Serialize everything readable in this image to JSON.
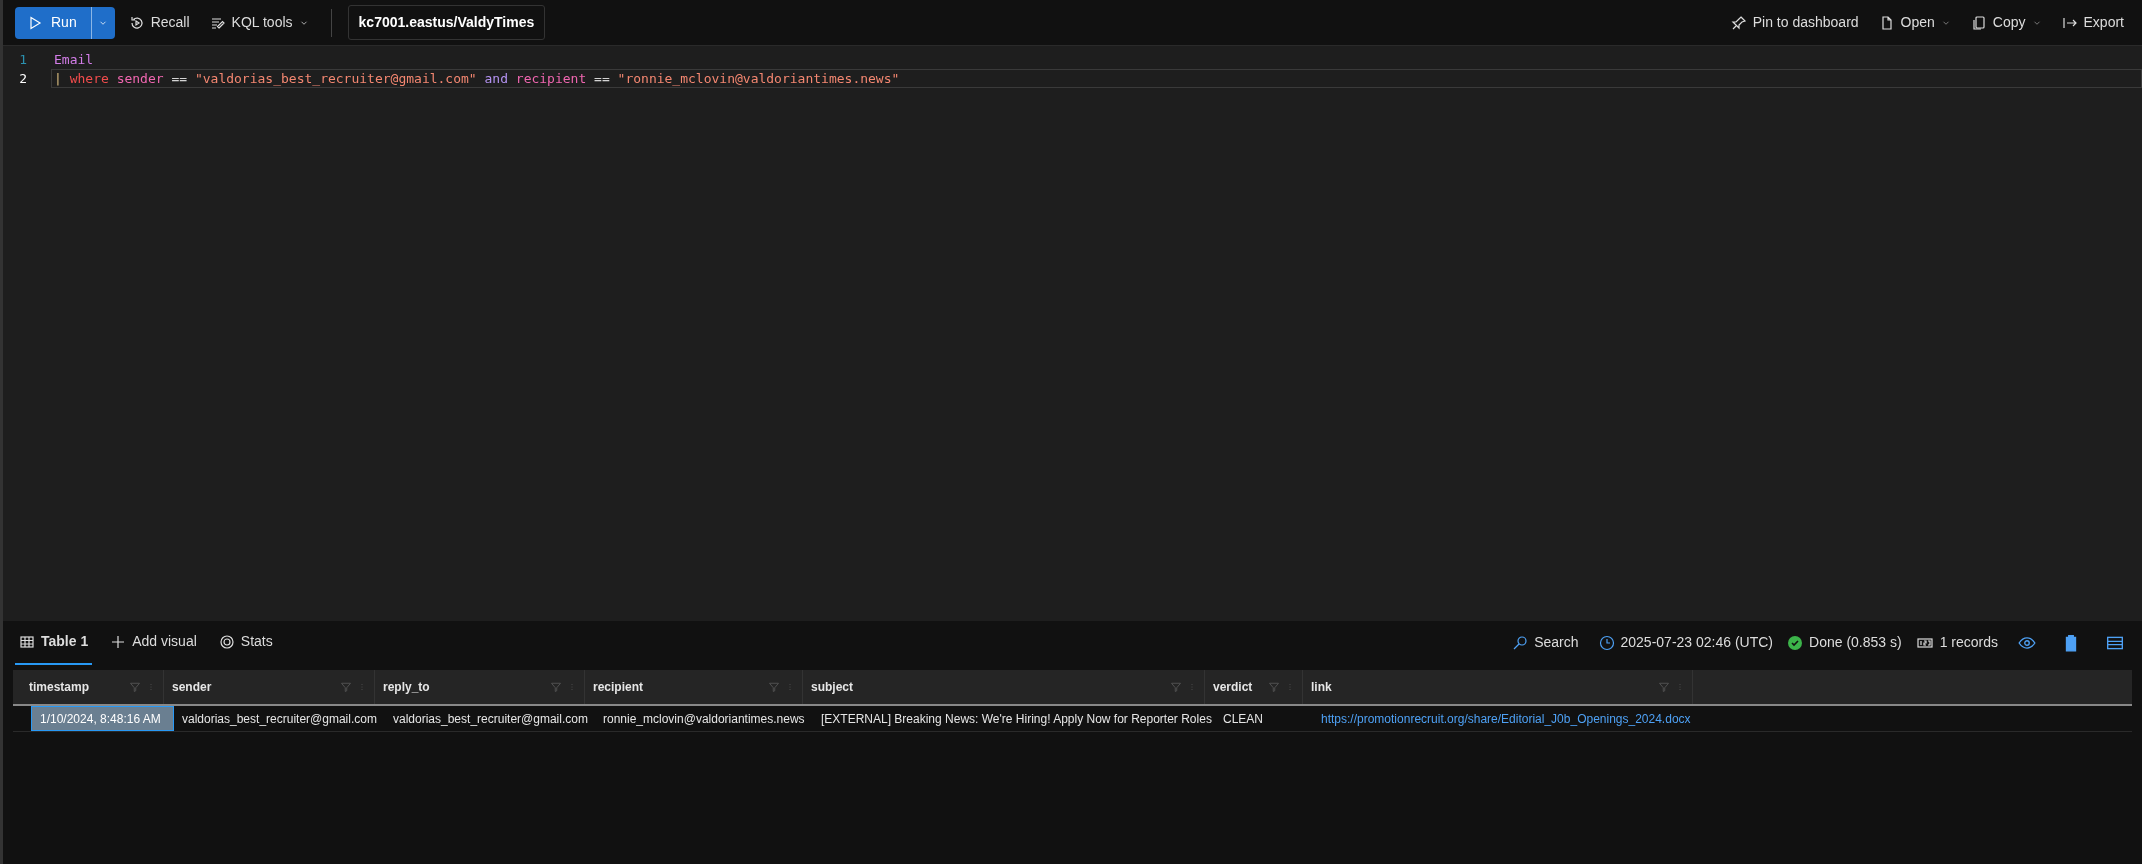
{
  "toolbar": {
    "run_label": "Run",
    "recall_label": "Recall",
    "kql_tools_label": "KQL tools",
    "database": "kc7001.eastus/ValdyTimes",
    "right_actions": [
      {
        "label": "Pin to dashboard",
        "kind": "pin",
        "caret": false
      },
      {
        "label": "Open",
        "kind": "file",
        "caret": true
      },
      {
        "label": "Copy",
        "kind": "copy",
        "caret": true
      },
      {
        "label": "Export",
        "kind": "export",
        "caret": false
      }
    ]
  },
  "editor": {
    "lines": [
      {
        "number": "1",
        "current": false,
        "tokens": [
          {
            "text": "Email",
            "kind": "table"
          }
        ]
      },
      {
        "number": "2",
        "current": true,
        "tokens": [
          {
            "text": "|",
            "kind": "pipe"
          },
          {
            "text": "where",
            "kind": "keyword"
          },
          {
            "text": "sender",
            "kind": "column"
          },
          {
            "text": "==",
            "kind": "operator"
          },
          {
            "text": "\"valdorias_best_recruiter@gmail.com\"",
            "kind": "string"
          },
          {
            "text": "and",
            "kind": "logic"
          },
          {
            "text": "recipient",
            "kind": "column"
          },
          {
            "text": "==",
            "kind": "operator"
          },
          {
            "text": "\"ronnie_mclovin@valdoriantimes.news\"",
            "kind": "string"
          }
        ]
      }
    ]
  },
  "results": {
    "tabs": [
      {
        "label": "Table 1",
        "kind": "table",
        "selected": true
      },
      {
        "label": "Add visual",
        "kind": "add",
        "selected": false
      },
      {
        "label": "Stats",
        "kind": "stats",
        "selected": false
      }
    ],
    "search_label": "Search",
    "timestamp": "2025-07-23 02:46 (UTC)",
    "status": "Done (0.853 s)",
    "records": "1 records",
    "table": {
      "columns": [
        "timestamp",
        "sender",
        "reply_to",
        "recipient",
        "subject",
        "verdict",
        "link"
      ],
      "rows": [
        {
          "cells": [
            {
              "text": "1/10/2024, 8:48:16 AM",
              "selected": true
            },
            {
              "text": "valdorias_best_recruiter@gmail.com",
              "selected": false
            },
            {
              "text": "valdorias_best_recruiter@gmail.com",
              "selected": false
            },
            {
              "text": "ronnie_mclovin@valdoriantimes.news",
              "selected": false
            },
            {
              "text": "[EXTERNAL] Breaking News: We're Hiring! Apply Now for Reporter Roles",
              "selected": false
            },
            {
              "text": "CLEAN",
              "selected": false
            },
            {
              "text": "https://promotionrecruit.org/share/Editorial_J0b_Openings_2024.docx",
              "selected": false
            }
          ]
        }
      ]
    }
  }
}
